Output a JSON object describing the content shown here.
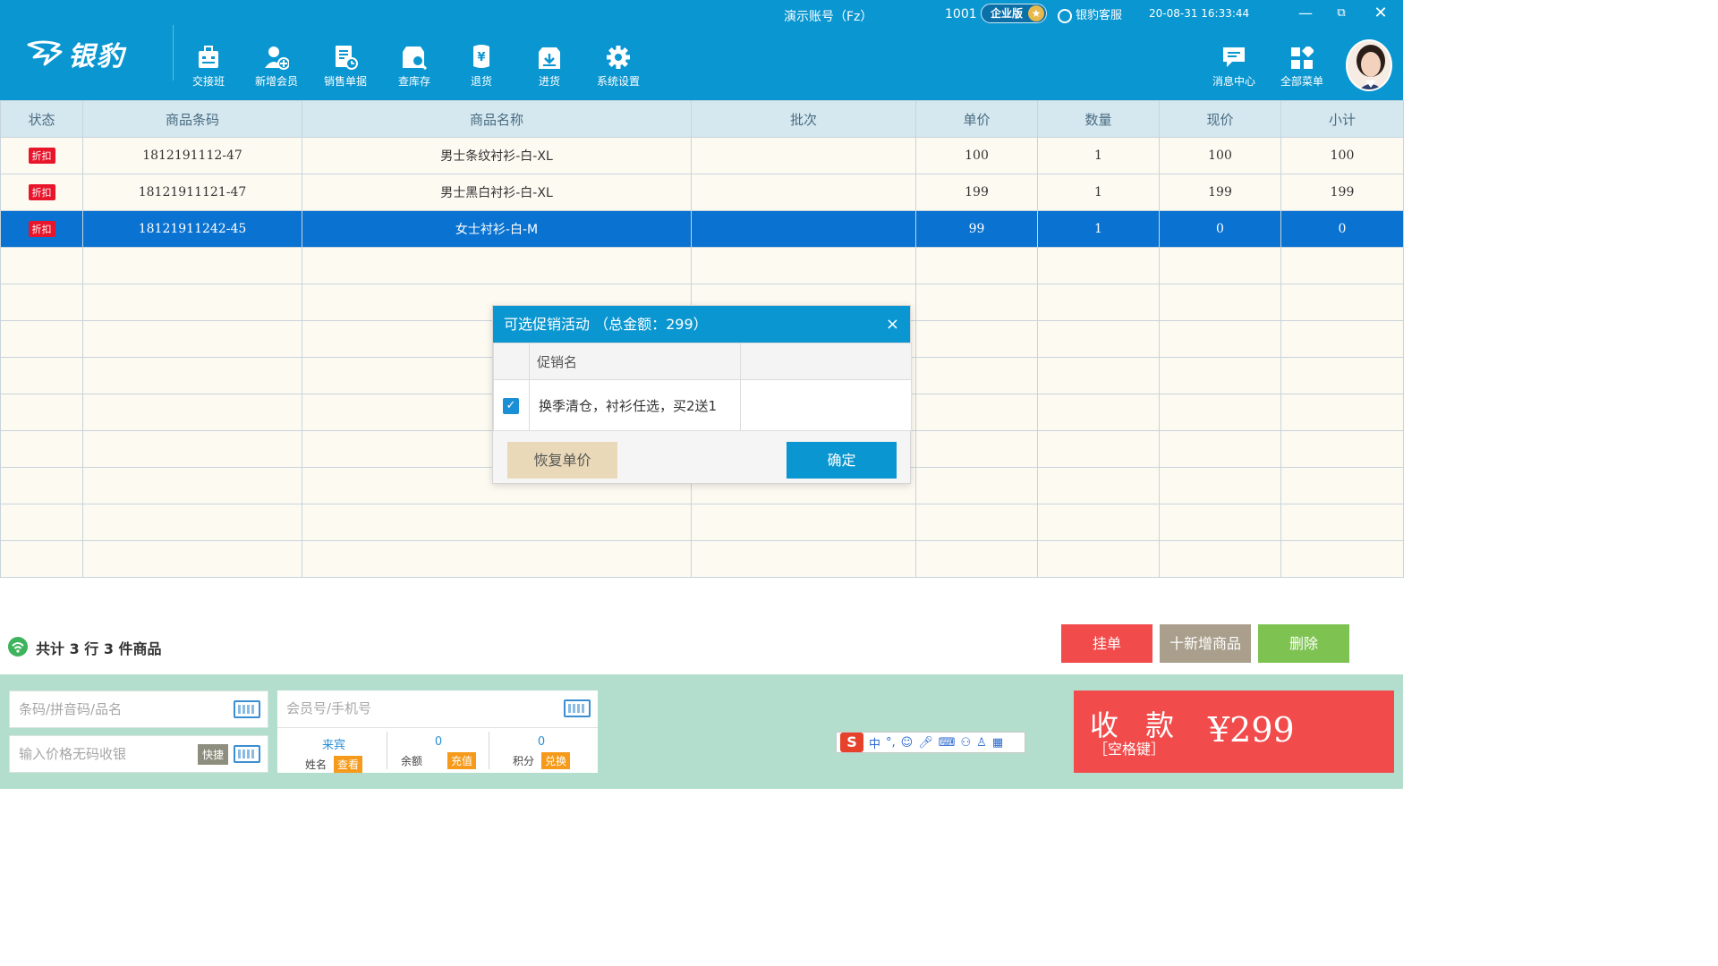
{
  "app": {
    "logo_text": "银豹",
    "account": "演示账号（Fz）",
    "user_id": "1001",
    "edition": "企业版",
    "support": "银豹客服",
    "datetime": "20-08-31 16:33:44"
  },
  "toolbar": [
    {
      "label": "交接班",
      "icon": "briefcase-icon"
    },
    {
      "label": "新增会员",
      "icon": "add-member-icon"
    },
    {
      "label": "销售单据",
      "icon": "sales-doc-icon"
    },
    {
      "label": "查库存",
      "icon": "inventory-search-icon"
    },
    {
      "label": "退货",
      "icon": "return-icon"
    },
    {
      "label": "进货",
      "icon": "stock-in-icon"
    },
    {
      "label": "系统设置",
      "icon": "gear-icon"
    }
  ],
  "right_toolbar": [
    {
      "label": "消息中心",
      "icon": "message-icon"
    },
    {
      "label": "全部菜单",
      "icon": "menu-grid-icon"
    }
  ],
  "table": {
    "headers": [
      "状态",
      "商品条码",
      "商品名称",
      "批次",
      "单价",
      "数量",
      "现价",
      "小计"
    ],
    "rows": [
      {
        "status": "折扣",
        "barcode": "1812191112-47",
        "name": "男士条纹衬衫-白-XL",
        "batch": "",
        "price": "100",
        "qty": "1",
        "current": "100",
        "subtotal": "100"
      },
      {
        "status": "折扣",
        "barcode": "18121911121-47",
        "name": "男士黑白衬衫-白-XL",
        "batch": "",
        "price": "199",
        "qty": "1",
        "current": "199",
        "subtotal": "199"
      },
      {
        "status": "折扣",
        "barcode": "18121911242-45",
        "name": "女士衬衫-白-M",
        "batch": "",
        "price": "99",
        "qty": "1",
        "current": "0",
        "subtotal": "0"
      }
    ]
  },
  "summary": {
    "text": "共计 3 行 3 件商品",
    "hold_label": "挂单",
    "add_label": "十新增商品",
    "delete_label": "删除"
  },
  "inputs": {
    "barcode_placeholder": "条码/拼音码/品名",
    "price_placeholder": "输入价格无码收银",
    "quick_label": "快捷",
    "member_placeholder": "会员号/手机号"
  },
  "member": {
    "name_value": "来宾",
    "name_label": "姓名",
    "view_label": "查看",
    "balance_value": "0",
    "balance_label": "余额",
    "recharge_label": "充值",
    "points_value": "0",
    "points_label": "积分",
    "exchange_label": "兑换"
  },
  "ime": {
    "lang": "中",
    "punct": "°,"
  },
  "pay": {
    "title": "收 款",
    "hint": "［空格键］",
    "amount": "¥299"
  },
  "dialog": {
    "title": "可选促销活动 （总金额：299）",
    "close": "×",
    "column": "促销名",
    "promo": "换季清仓，衬衫任选，买2送1",
    "restore_label": "恢复单价",
    "confirm_label": "确定"
  },
  "colors": {
    "header_bg": "#0a96d0",
    "selected_row": "#0a72d0",
    "discount_tag": "#e8152b",
    "hold_button": "#f24b4b",
    "add_button": "#a99f8c",
    "delete_button": "#7ec352",
    "pay_button": "#f24b4b",
    "bottom_bg": "#b3dece"
  }
}
